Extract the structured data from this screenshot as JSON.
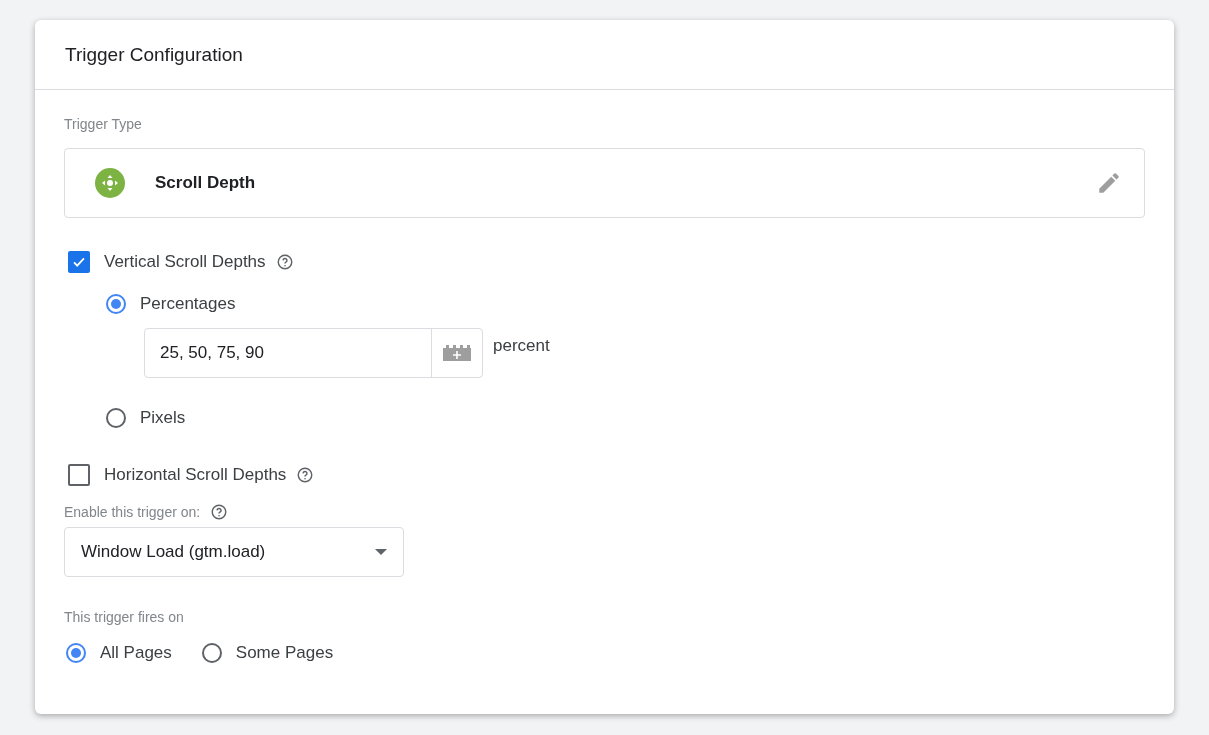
{
  "card": {
    "title": "Trigger Configuration"
  },
  "trigger_type": {
    "label": "Trigger Type",
    "name": "Scroll Depth"
  },
  "vertical": {
    "label": "Vertical Scroll Depths",
    "checked": true,
    "options": [
      {
        "label": "Percentages",
        "selected": true,
        "value": "25, 50, 75, 90",
        "unit": "percent"
      },
      {
        "label": "Pixels",
        "selected": false
      }
    ]
  },
  "horizontal": {
    "label": "Horizontal Scroll Depths",
    "checked": false
  },
  "enable": {
    "label": "Enable this trigger on:",
    "value": "Window Load (gtm.load)"
  },
  "fires_on": {
    "label": "This trigger fires on",
    "options": [
      {
        "label": "All Pages",
        "selected": true
      },
      {
        "label": "Some Pages",
        "selected": false
      }
    ]
  }
}
